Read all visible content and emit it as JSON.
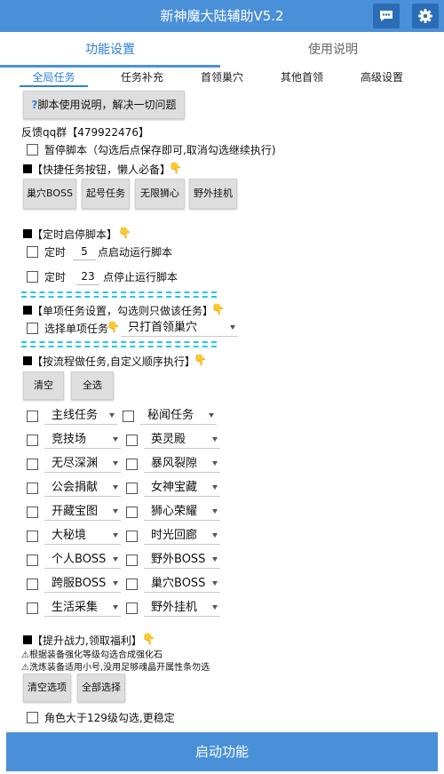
{
  "app": {
    "title": "新神魔大陆辅助V5.2"
  },
  "main_tabs": [
    "功能设置",
    "使用说明"
  ],
  "sub_tabs": [
    "全局任务",
    "任务补充",
    "首领巢穴",
    "其他首领",
    "高级设置"
  ],
  "help_button": "脚本使用说明，解决一切问题",
  "feedback": "反馈qq群【479922476】",
  "pause": "暂停脚本（勾选后点保存即可,取消勾选继续执行)",
  "quick": {
    "title": "【快捷任务按钮，懒人必备】",
    "buttons": [
      "巢穴BOSS",
      "起号任务",
      "无限狮心",
      "野外挂机"
    ]
  },
  "timer": {
    "title": "【定时启停脚本】",
    "start": {
      "label": "定时",
      "value": "5",
      "suffix": "点启动运行脚本"
    },
    "stop": {
      "label": "定时",
      "value": "23",
      "suffix": "点停止运行脚本"
    }
  },
  "single": {
    "title": "【单项任务设置，勾选则只做该任务】",
    "label": "选择单项任务",
    "selected": "只打首领巢穴"
  },
  "flow": {
    "title": "【按流程做任务,自定义顺序执行】",
    "clear_btn": "清空",
    "all_btn": "全选",
    "left": [
      "主线任务",
      "竞技场",
      "无尽深渊",
      "公会捐献",
      "开藏宝图",
      "大秘境",
      "个人BOSS",
      "跨服BOSS",
      "生活采集"
    ],
    "right": [
      "秘闻任务",
      "英灵殿",
      "暴风裂隙",
      "女神宝藏",
      "狮心荣耀",
      "时光回廊",
      "野外BOSS",
      "巢穴BOSS",
      "野外挂机"
    ]
  },
  "boost": {
    "title": "【提升战力,领取福利】",
    "note1": "根据装备强化等级勾选合成强化石",
    "note2": "洗炼装备适用小号,没用足够魂晶开属性条勿选",
    "clear_btn": "清空选项",
    "all_btn": "全部选择"
  },
  "level_check": "角色大于129级勾选,更稳定",
  "start_button": "启动功能",
  "icons": {
    "chat": "chat-bubble-icon",
    "settings": "gear-icon",
    "help": "question-icon",
    "hand": "pointing-hand-icon",
    "warn": "warning-icon"
  },
  "colors": {
    "primary": "#4a90d9",
    "accent": "#2c7fd8",
    "dash": "#26c6e8"
  }
}
